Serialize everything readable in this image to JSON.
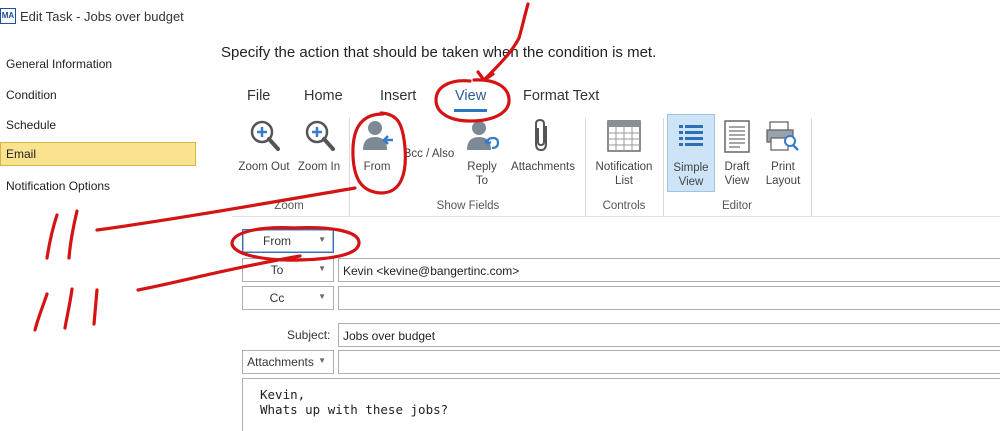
{
  "window": {
    "app_icon_text": "MA",
    "title": "Edit Task - Jobs over budget"
  },
  "nav": {
    "items": [
      {
        "label": "General Information"
      },
      {
        "label": "Condition"
      },
      {
        "label": "Schedule"
      },
      {
        "label": "Email",
        "selected": true
      },
      {
        "label": "Notification Options"
      }
    ]
  },
  "instruction": "Specify the action that should be taken when the condition is met.",
  "ribbon": {
    "tabs": [
      "File",
      "Home",
      "Insert",
      "View",
      "Format Text"
    ],
    "active_tab": "View",
    "buttons": {
      "zoom_out": "Zoom Out",
      "zoom_in": "Zoom In",
      "from": "From",
      "bcc": "Bcc / Also",
      "reply_to_1": "Reply",
      "reply_to_2": "To",
      "attachments": "Attachments",
      "notification_list_1": "Notification",
      "notification_list_2": "List",
      "simple_view_1": "Simple",
      "simple_view_2": "View",
      "draft_view_1": "Draft",
      "draft_view_2": "View",
      "print_layout_1": "Print",
      "print_layout_2": "Layout"
    },
    "groups": {
      "zoom": "Zoom",
      "show_fields": "Show Fields",
      "controls": "Controls",
      "editor": "Editor"
    },
    "pressed_button": "Simple View"
  },
  "form": {
    "from_label": "From",
    "to_label": "To",
    "to_value": "Kevin <kevine@bangertinc.com>",
    "cc_label": "Cc",
    "cc_value": "",
    "subject_label": "Subject:",
    "subject_value": "Jobs over budget",
    "attachments_label": "Attachments",
    "attachments_value": "",
    "body_line1": "Kevin,",
    "body_line2": "Whats up with these jobs?"
  },
  "colors": {
    "selected_nav_bg": "#fbe28e",
    "active_tab_underline": "#2a78c4",
    "pressed_button_bg": "#cde4f7",
    "annotation_red": "#d41414"
  }
}
